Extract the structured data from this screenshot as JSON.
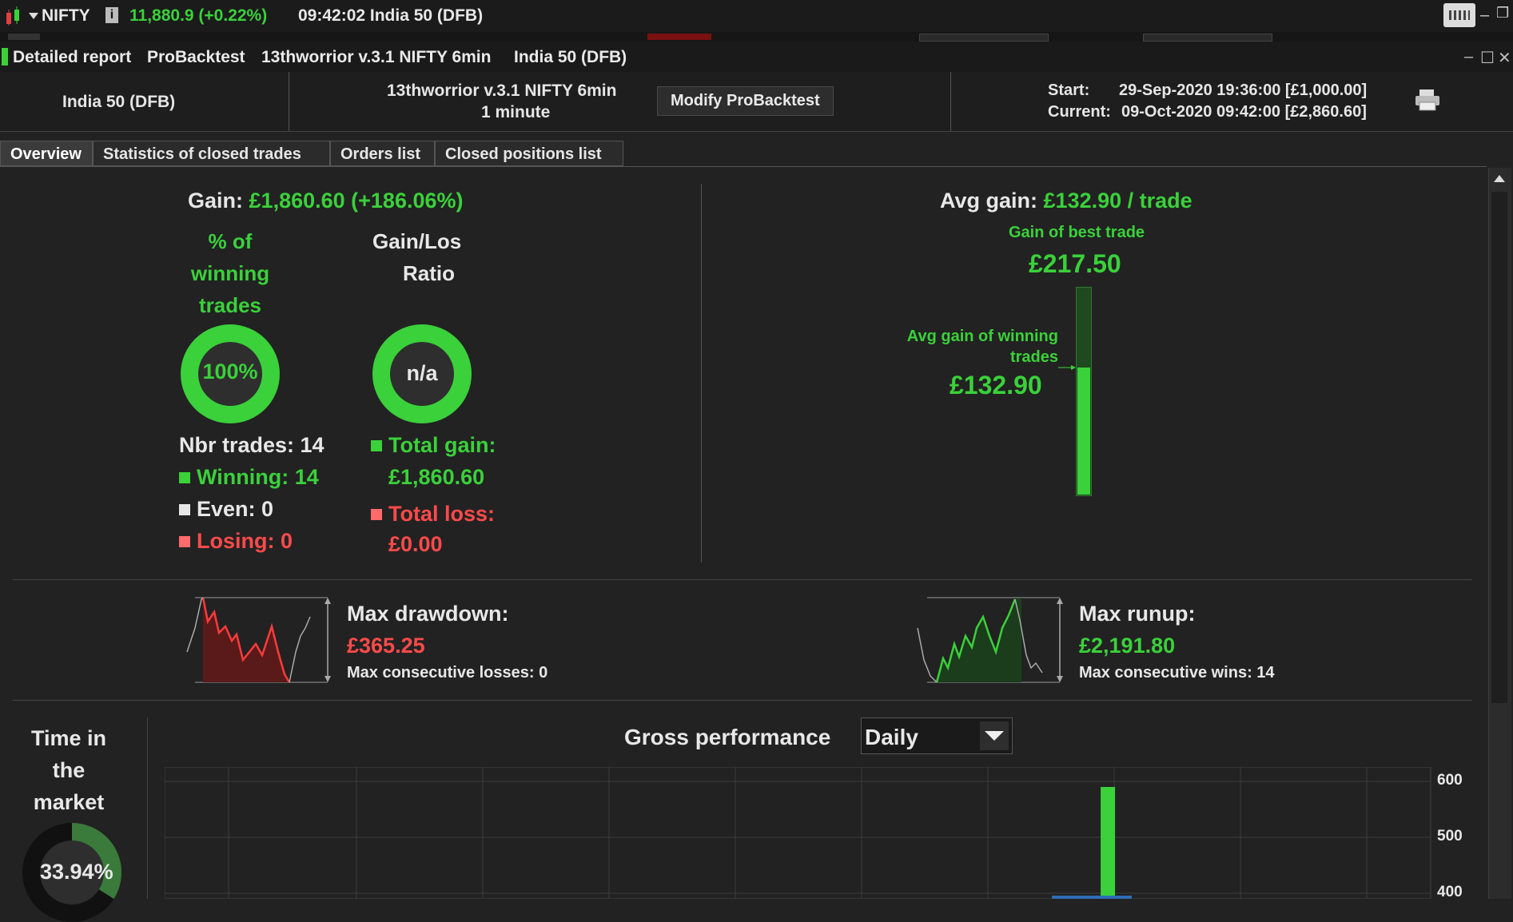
{
  "topbar": {
    "symbol": "NIFTY",
    "info_glyph": "i",
    "price_change": "11,880.9 (+0.22%)",
    "time_market": "09:42:02 India 50 (DFB)"
  },
  "titlebar": {
    "title_parts": [
      "Detailed report",
      "ProBacktest",
      "13thworrior v.3.1 NIFTY 6min",
      "India 50 (DFB)"
    ],
    "min_glyph": "–",
    "max_glyph": "☐",
    "close_glyph": "✕"
  },
  "header": {
    "instrument": "India 50 (DFB)",
    "system_name": "13thworrior v.3.1 NIFTY 6min",
    "timeframe": "1 minute",
    "modify_button": "Modify ProBacktest",
    "start_label": "Start:",
    "start_value": "29-Sep-2020 19:36:00 [£1,000.00]",
    "current_label": "Current:",
    "current_value": "09-Oct-2020 09:42:00 [£2,860.60]"
  },
  "tabs": [
    {
      "label": "Overview",
      "active": true
    },
    {
      "label": "Statistics of closed trades",
      "active": false
    },
    {
      "label": "Orders list",
      "active": false
    },
    {
      "label": "Closed positions list",
      "active": false
    }
  ],
  "overview": {
    "gain_label": "Gain:",
    "gain_value": "£1,860.60 (+186.06%)",
    "winning_pct_title": [
      "% of",
      "winning",
      "trades"
    ],
    "winning_pct_value": "100%",
    "winning_pct": 100,
    "gl_ratio_title": [
      "Gain/Los",
      "Ratio"
    ],
    "gl_ratio_value": "n/a",
    "nbr_trades": "Nbr trades: 14",
    "winning": "Winning: 14",
    "even": "Even: 0",
    "losing": "Losing: 0",
    "total_gain_label": "Total gain:",
    "total_gain_value": "£1,860.60",
    "total_loss_label": "Total loss:",
    "total_loss_value": "£0.00",
    "avg_gain_label": "Avg gain:",
    "avg_gain_value": "£132.90 / trade",
    "best_trade_label": "Gain of best trade",
    "best_trade_value": "£217.50",
    "avg_winning_label_1": "Avg gain of winning",
    "avg_winning_label_2": "trades",
    "avg_winning_value": "£132.90",
    "avg_to_best_fraction": 0.611
  },
  "drawdown": {
    "label": "Max drawdown:",
    "value": "£365.25",
    "consecutive": "Max consecutive losses: 0"
  },
  "runup": {
    "label": "Max runup:",
    "value": "£2,191.80",
    "consecutive": "Max consecutive wins: 14"
  },
  "time_in_market": {
    "title": [
      "Time in",
      "the",
      "market"
    ],
    "value": "33.94%",
    "pct": 33.94
  },
  "gross_performance": {
    "title": "Gross performance",
    "period_selected": "Daily"
  },
  "colors": {
    "green": "#3ad13a",
    "red": "#ff4a4a",
    "background": "#222222"
  },
  "chart_data": {
    "type": "bar",
    "title": "Gross performance",
    "y_ticks": [
      600,
      500,
      400
    ],
    "ylim": [
      400,
      620
    ],
    "x_bar_position": 0.745,
    "values": [
      590
    ],
    "grid": true
  }
}
